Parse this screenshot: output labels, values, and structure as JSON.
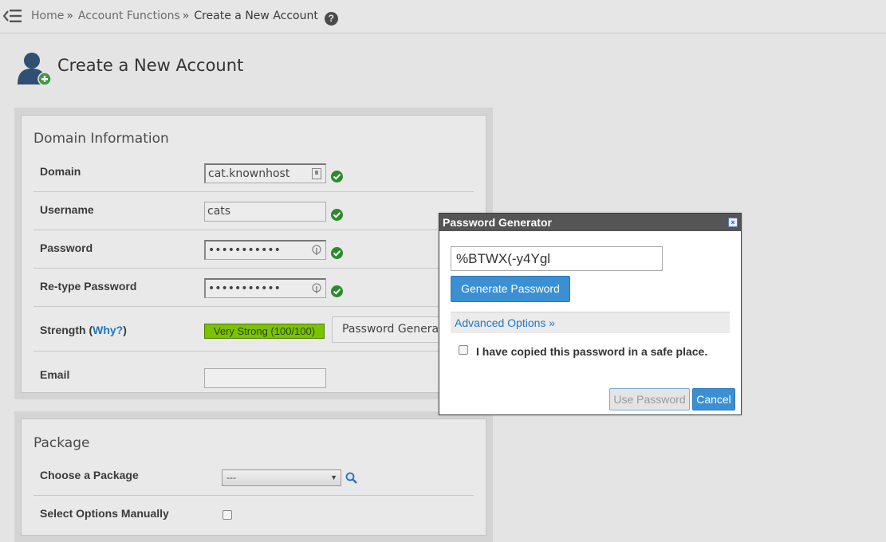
{
  "breadcrumb": {
    "home": "Home",
    "section": "Account Functions",
    "current": "Create a New Account",
    "separator": "»"
  },
  "page": {
    "title": "Create a New Account"
  },
  "domain_panel": {
    "title": "Domain Information",
    "domain": {
      "label": "Domain",
      "value": "cat.knownhost"
    },
    "username": {
      "label": "Username",
      "value": "cats"
    },
    "password": {
      "label": "Password",
      "value": "•••••••••••"
    },
    "retype": {
      "label": "Re-type Password",
      "value": "•••••••••••"
    },
    "strength": {
      "label_prefix": "Strength (",
      "why_link": "Why?",
      "label_suffix": ")",
      "bar_text": "Very Strong (100/100)",
      "score": 100,
      "color": "#7cc200"
    },
    "password_generator_button": "Password Generator",
    "email": {
      "label": "Email",
      "value": ""
    }
  },
  "package_panel": {
    "title": "Package",
    "choose": {
      "label": "Choose a Package",
      "selected": "---"
    },
    "manual": {
      "label": "Select Options Manually",
      "checked": false
    }
  },
  "dialog": {
    "title": "Password Generator",
    "close": "×",
    "generated_password": "%BTWX(-y4Ygl",
    "generate_button": "Generate Password",
    "advanced_link": "Advanced Options »",
    "copied_label": "I have copied this password in a safe place.",
    "copied_checked": false,
    "use_button": "Use Password",
    "cancel_button": "Cancel"
  },
  "colors": {
    "accent": "#3b8fd3",
    "link": "#1f77c4",
    "ok_green": "#2d8a2d",
    "dialog_header": "#555555"
  }
}
